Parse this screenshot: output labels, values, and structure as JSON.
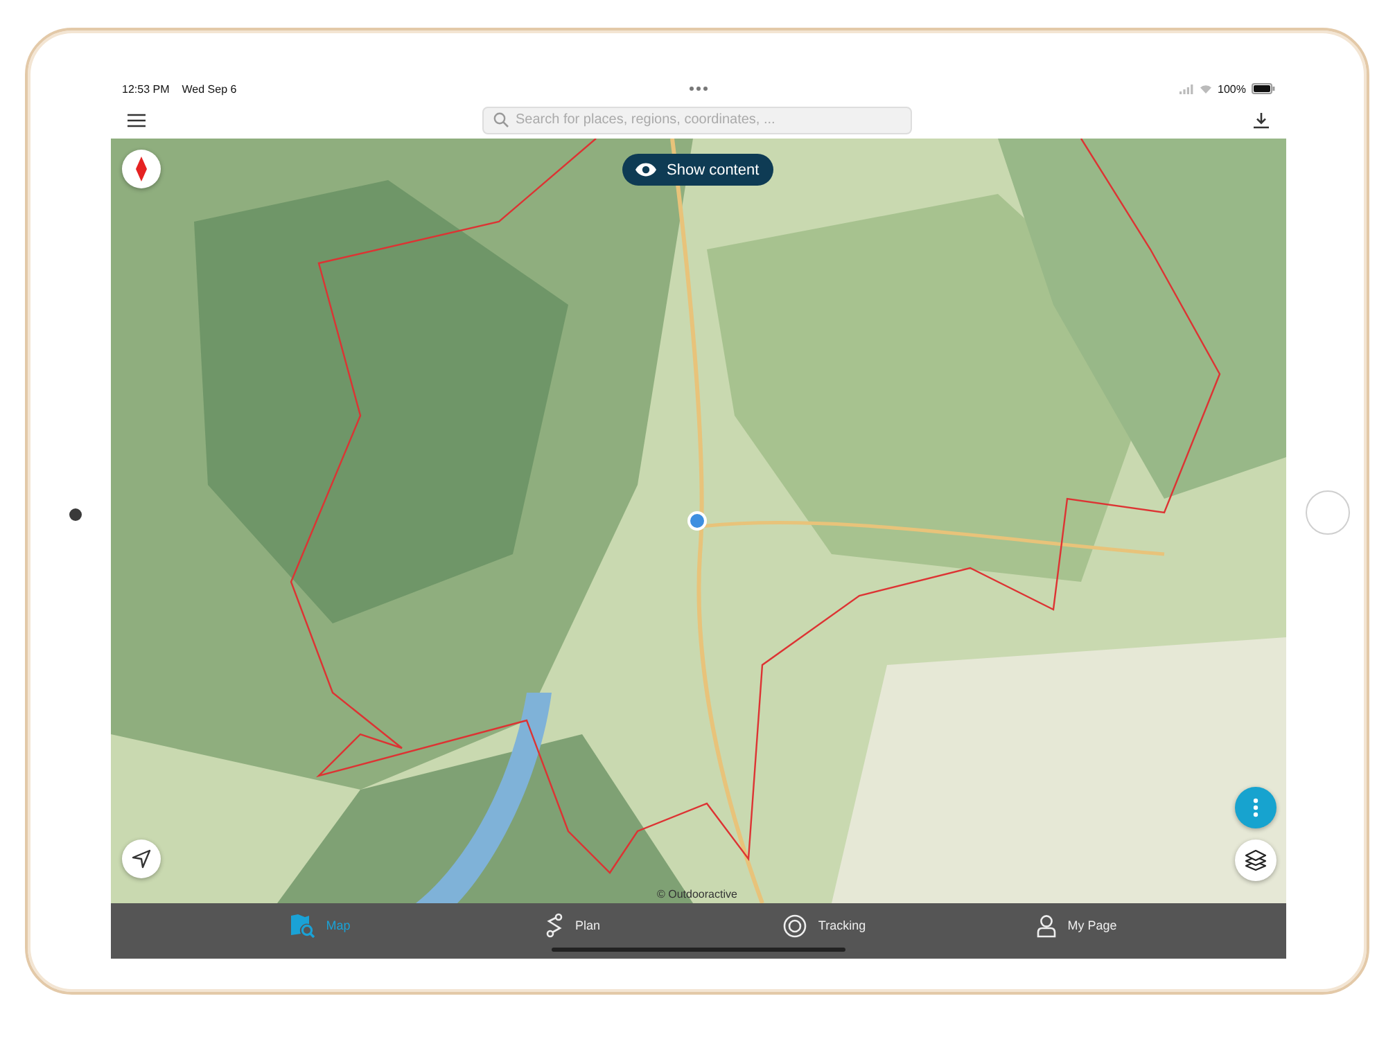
{
  "status_bar": {
    "time": "12:53 PM",
    "date": "Wed Sep 6",
    "battery": "100%"
  },
  "toolbar": {
    "search": {
      "placeholder": "Search for places, regions, coordinates, ..."
    }
  },
  "map": {
    "show_content_button": "Show content",
    "attribution": "© Outdooractive"
  },
  "tabs": [
    {
      "label": "Map",
      "kind": "map",
      "selected": true
    },
    {
      "label": "Plan",
      "kind": "plan",
      "selected": false
    },
    {
      "label": "Tracking",
      "kind": "tracking",
      "selected": false
    },
    {
      "label": "My Page",
      "kind": "person",
      "selected": false
    }
  ]
}
